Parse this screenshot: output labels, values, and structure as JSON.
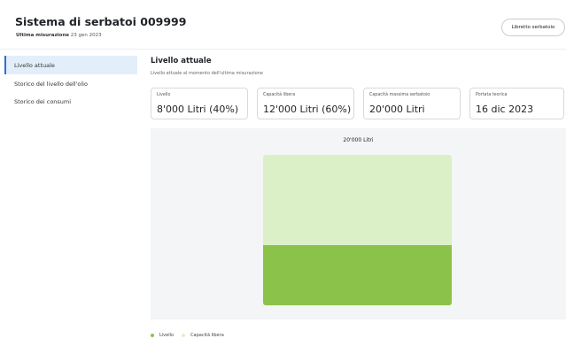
{
  "header": {
    "title": "Sistema di serbatoi 009999",
    "last_measure_label": "Ultima misurazione",
    "last_measure_date": "23 gen 2023",
    "button_label": "Libretto serbatoio"
  },
  "sidebar": {
    "items": [
      {
        "label": "Livello attuale",
        "active": true
      },
      {
        "label": "Storico del livello dell'olio",
        "active": false
      },
      {
        "label": "Storico dei consumi",
        "active": false
      }
    ]
  },
  "main": {
    "title": "Livello attuale",
    "subtitle": "Livello attuale al momento dell'ultima misurazione",
    "cards": [
      {
        "label": "Livello",
        "value": "8'000 Litri (40%)"
      },
      {
        "label": "Capacità libera",
        "value": "12'000 Litri (60%)"
      },
      {
        "label": "Capacità massima serbatoio",
        "value": "20'000 Litri"
      },
      {
        "label": "Portata teorica",
        "value": "16 dic 2023"
      }
    ],
    "tank_label": "20'000 Litri",
    "fill_fraction": 0.4,
    "legend": [
      {
        "label": "Livello",
        "color": "#8bc34a"
      },
      {
        "label": "Capacità libera",
        "color": "#dcf0c8"
      }
    ]
  }
}
